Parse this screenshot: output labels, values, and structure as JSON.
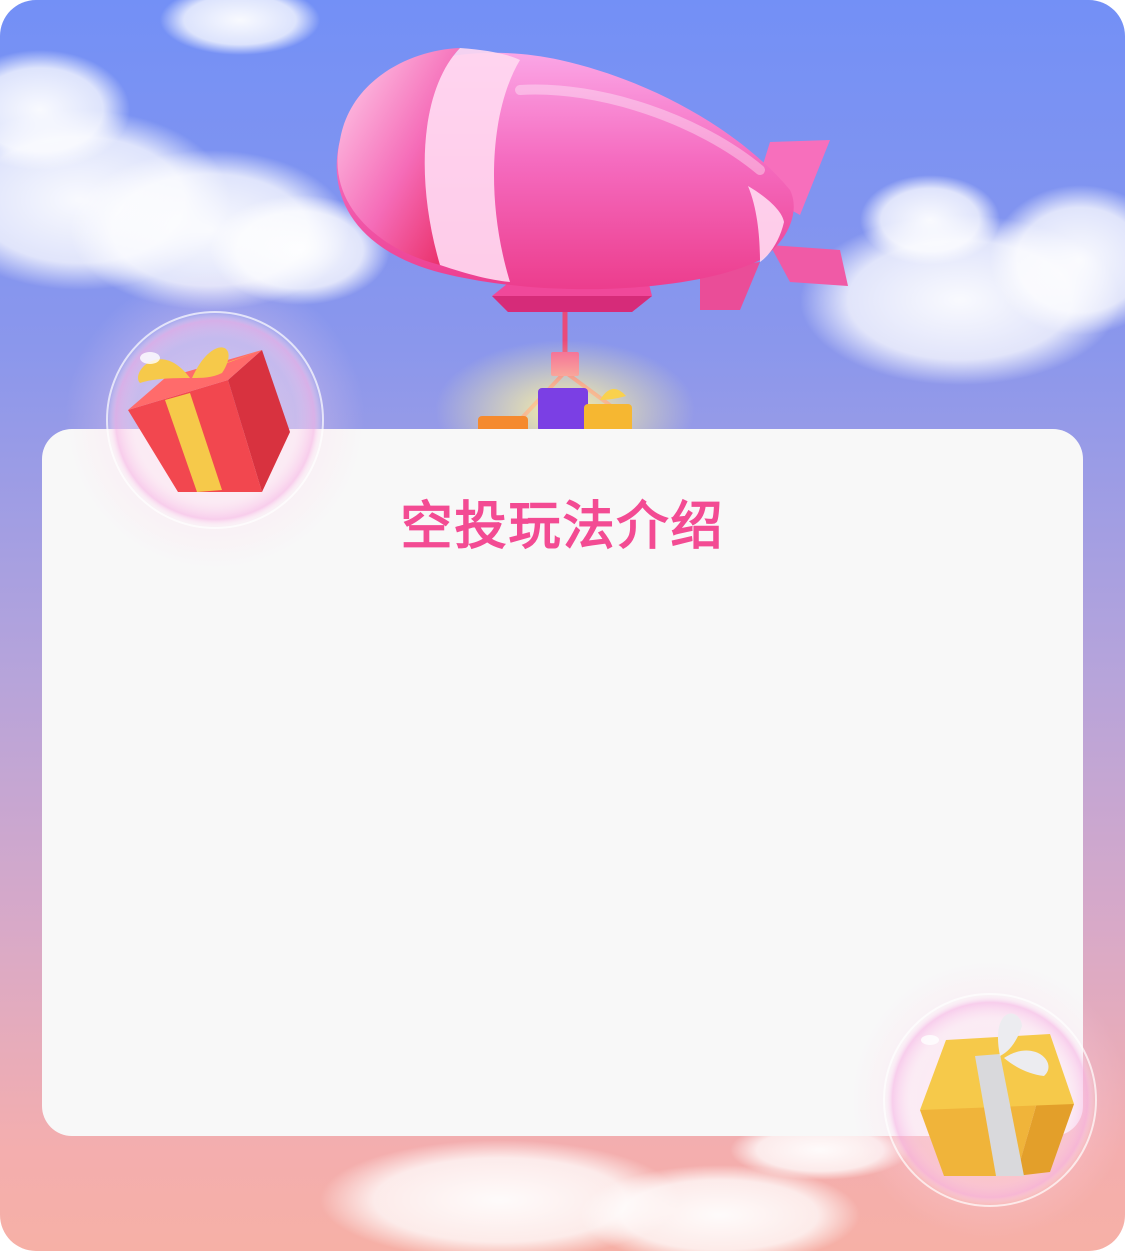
{
  "page": {
    "title": "空投玩法介绍"
  },
  "colors": {
    "title": "#f34b93",
    "card_background": "#f8f8f8",
    "sky_top": "#7390f6",
    "sky_bottom": "#f6b0a6",
    "airship": "#f569b8",
    "gift_red": "#f2474f",
    "gift_yellow": "#f6c94a"
  },
  "icons": {
    "airship": "airship-illustration",
    "gift_left": "red-gift-bubble",
    "gift_right": "yellow-gift-bubble"
  }
}
